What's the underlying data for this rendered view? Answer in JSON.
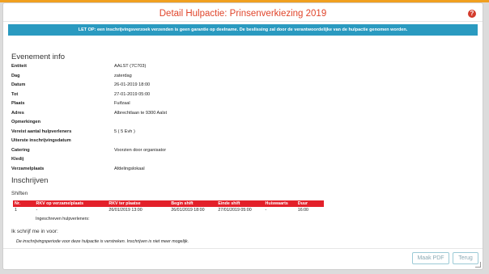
{
  "title": "Detail Hulpactie: Prinsenverkiezing 2019",
  "help_icon": "help-icon",
  "alert": "LET OP: een inschrijvingsverzoek verzenden is geen garantie op deelname. De beslissing zal door de verantwoordelijke van de hulpactie genomen worden.",
  "event_section_title": "Evenement info",
  "event": [
    {
      "label": "Entiteit",
      "value": "AALST (7C703)"
    },
    {
      "label": "Dag",
      "value": "zaterdag"
    },
    {
      "label": "Datum",
      "value": "26-01-2019 18:00"
    },
    {
      "label": "Tot",
      "value": "27-01-2019 05:00"
    },
    {
      "label": "Plaats",
      "value": "Fuifzaal"
    },
    {
      "label": "Adres",
      "value": "Albrechtlaan te 9300 Aalst"
    },
    {
      "label": "Opmerkingen",
      "value": ""
    },
    {
      "label": "Vereist aantal hulpverleners",
      "value": "5 ( 5 Evh )"
    },
    {
      "label": "Uiterste inschrijvingsdatum",
      "value": ""
    },
    {
      "label": "Catering",
      "value": "Voorzien door organisator"
    },
    {
      "label": "Kledij",
      "value": ""
    },
    {
      "label": "Verzamelplaats",
      "value": "Afdelingslokaal"
    }
  ],
  "register_section_title": "Inschrijven",
  "shifts_title": "Shiften",
  "shift_columns": [
    "Nr.",
    "RKV op verzamelplaats",
    "RKV ter plaatse",
    "Begin shift",
    "Einde shift",
    "Huiswaarts",
    "Duur"
  ],
  "shift_rows": [
    [
      "1",
      "-",
      "26/01/2019 13:00",
      "26/01/2019 18:00",
      "27/01/2019 05:00",
      "-",
      "16:00"
    ]
  ],
  "registered_label": "Ingeschreven hulpverleners:",
  "signup_label": "Ik schrijf me in voor:",
  "expired_message": "De inschrijvingsperiode voor deze hulpactie is verstreken. Inschrijven is niet meer mogelijk.",
  "buttons": {
    "pdf": "Maak PDF",
    "back": "Terug"
  },
  "colors": {
    "title": "#e0452b",
    "alert_bg": "#2a9ac0",
    "table_header": "#e3202a"
  }
}
